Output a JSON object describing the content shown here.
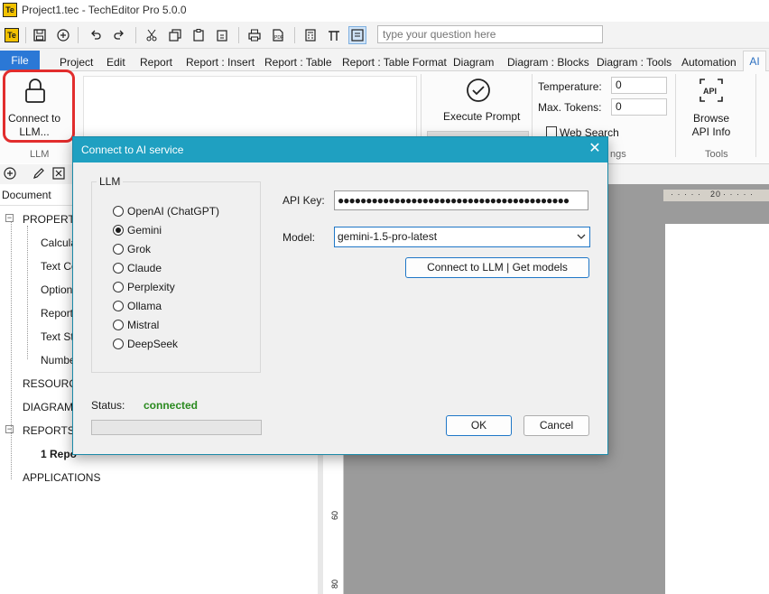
{
  "window": {
    "title": "Project1.tec - TechEditor Pro 5.0.0",
    "icon_text": "Te"
  },
  "qat": {
    "search_placeholder": "type your question here"
  },
  "tabs": [
    "File",
    "Project",
    "Edit",
    "Report",
    "Report : Insert",
    "Report : Table",
    "Report : Table Format",
    "Diagram",
    "Diagram : Blocks",
    "Diagram : Tools",
    "Automation",
    "AI"
  ],
  "ribbon": {
    "connect_label": "Connect to LLM...",
    "group_llm": "LLM",
    "execute_prompt": "Execute Prompt",
    "temperature_label": "Temperature:",
    "temperature_value": "0",
    "max_tokens_label": "Max. Tokens:",
    "max_tokens_value": "0",
    "web_search": "Web Search",
    "group_settings": "ngs",
    "browse_api": "Browse API Info",
    "group_tools": "Tools"
  },
  "left": {
    "doc_combo": "Document",
    "tree": {
      "properties": "PROPERTIE",
      "calc": "Calcula",
      "textc": "Text Co",
      "options": "Options",
      "report": "Report",
      "textst": "Text St",
      "number": "Numbe",
      "resources": "RESOURCE",
      "diagrams": "DIAGRAMS",
      "reports": "REPORTS (",
      "report1": "1  Repo",
      "applications": "APPLICATIONS"
    }
  },
  "rulers": {
    "top_mark": "20",
    "left_60": "60",
    "left_80": "80"
  },
  "dialog": {
    "title": "Connect to AI service",
    "llm_legend": "LLM",
    "providers": [
      "OpenAI (ChatGPT)",
      "Gemini",
      "Grok",
      "Claude",
      "Perplexity",
      "Ollama",
      "Mistral",
      "DeepSeek"
    ],
    "selected_provider": "Gemini",
    "api_key_label": "API Key:",
    "api_key_value": "●●●●●●●●●●●●●●●●●●●●●●●●●●●●●●●●●●●●●●●●●",
    "model_label": "Model:",
    "model_value": "gemini-1.5-pro-latest",
    "connect_button": "Connect to LLM | Get models",
    "status_label": "Status:",
    "status_value": "connected",
    "ok": "OK",
    "cancel": "Cancel"
  },
  "colors": {
    "file_tab": "#2b78d6",
    "dialog_title": "#1fa0c1",
    "status_ok": "#2a8a1f",
    "highlight": "#e22d2d"
  }
}
